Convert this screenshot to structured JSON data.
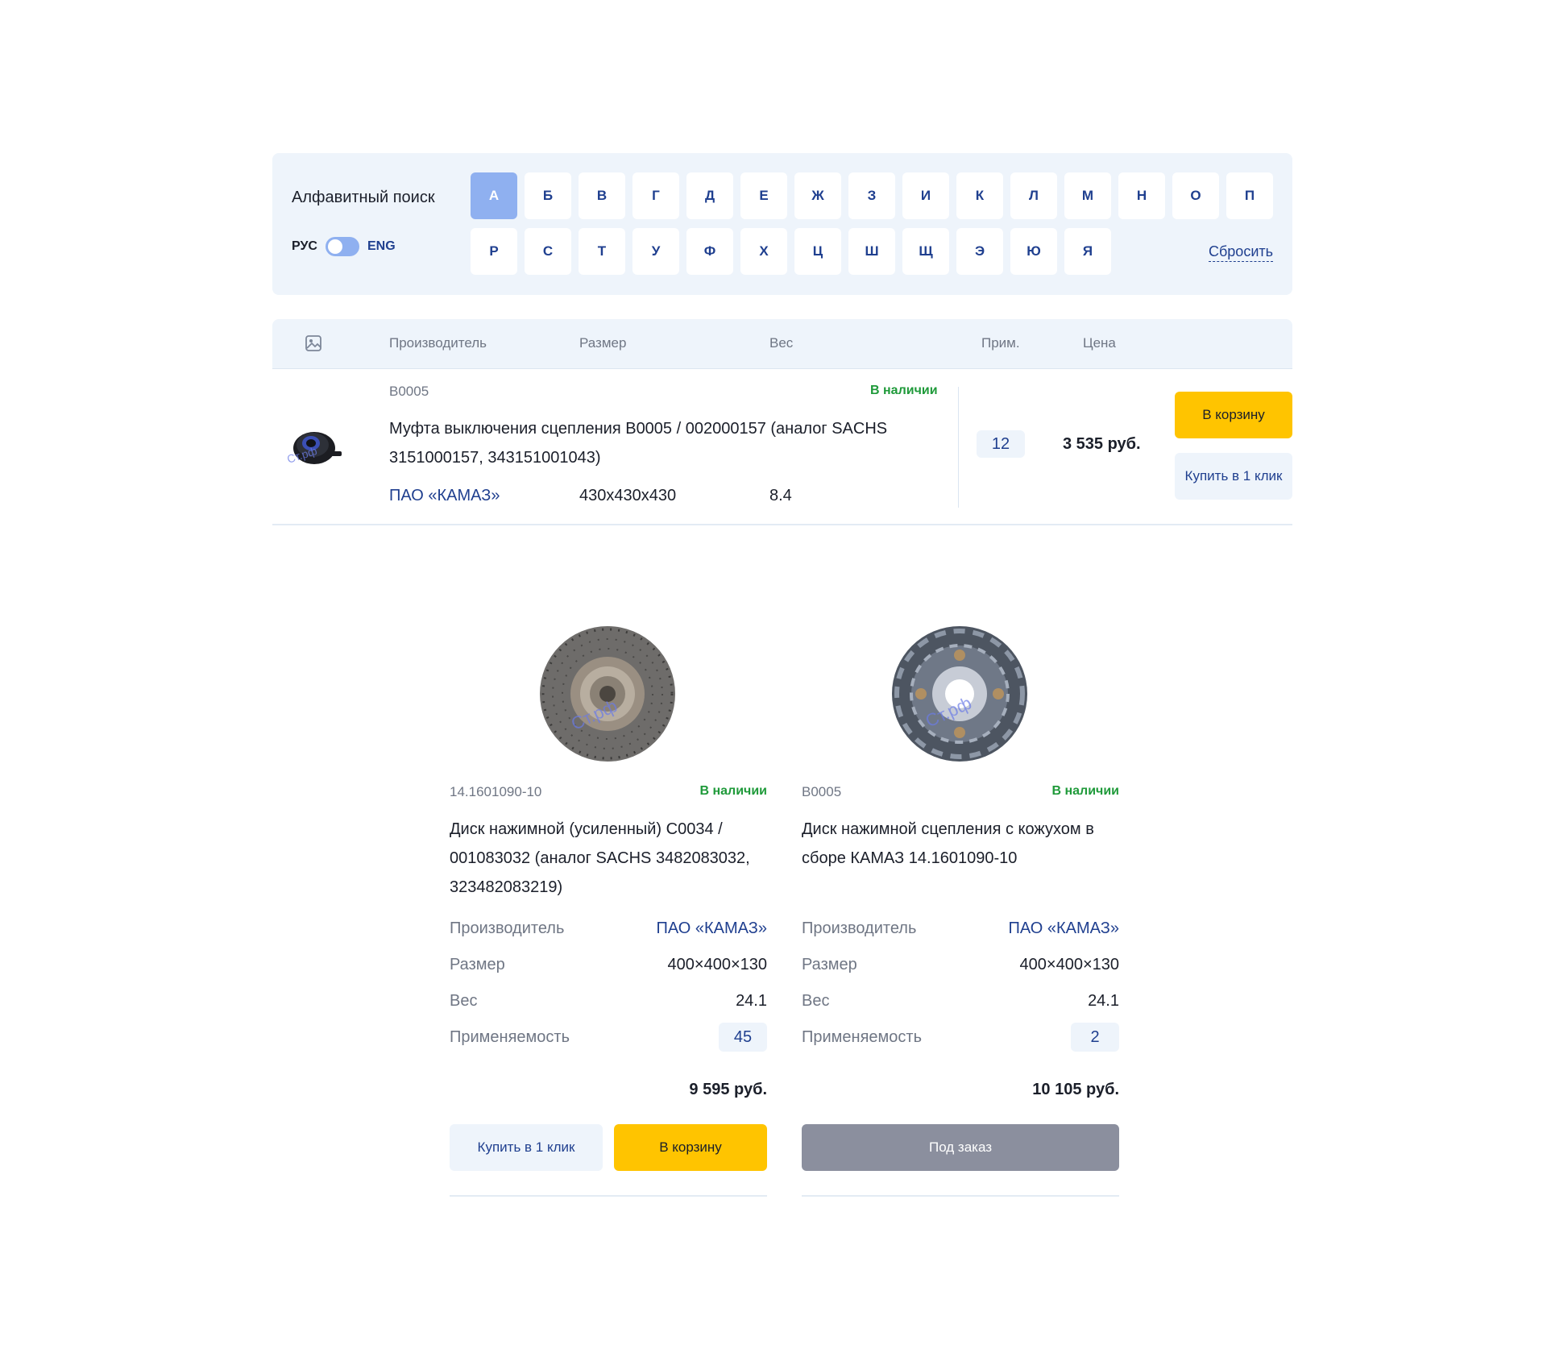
{
  "alphabet": {
    "title": "Алфавитный поиск",
    "lang_ru": "РУС",
    "lang_en": "ENG",
    "row1": [
      "А",
      "Б",
      "В",
      "Г",
      "Д",
      "Е",
      "Ж",
      "З",
      "И",
      "К",
      "Л",
      "М",
      "Н",
      "О",
      "П"
    ],
    "row2": [
      "Р",
      "С",
      "Т",
      "У",
      "Ф",
      "Х",
      "Ц",
      "Ш",
      "Щ",
      "Э",
      "Ю",
      "Я"
    ],
    "active_letter": "А",
    "reset_label": "Сбросить"
  },
  "table": {
    "headers": {
      "image_icon": "image-icon",
      "maker": "Производитель",
      "size": "Размер",
      "weight": "Вес",
      "applicability": "Прим.",
      "price": "Цена"
    },
    "rows": [
      {
        "sku": "B0005",
        "stock": "В наличии",
        "title": "Муфта выключения сцепления B0005 / 002000157 (аналог SACHS 3151000157, 343151001043)",
        "maker": "ПАО «КАМАЗ»",
        "size": "430x430x430",
        "weight": "8.4",
        "applicability": "12",
        "price": "3 535 руб.",
        "cart_label": "В корзину",
        "one_click_label": "Купить в 1 клик"
      }
    ]
  },
  "cards": [
    {
      "sku": "14.1601090-10",
      "stock": "В наличии",
      "title": "Диск нажимной (усиленный) C0034 / 001083032 (аналог SACHS 3482083032, 323482083219)",
      "specs": {
        "maker_label": "Производитель",
        "maker": "ПАО «КАМАЗ»",
        "size_label": "Размер",
        "size": "400×400×130",
        "weight_label": "Вес",
        "weight": "24.1",
        "applicability_label": "Применяемость",
        "applicability": "45"
      },
      "price": "9 595 руб.",
      "one_click_label": "Купить в 1 клик",
      "cart_label": "В корзину"
    },
    {
      "sku": "B0005",
      "stock": "В наличии",
      "title": "Диск нажимной сцепления с кожухом в сборе КАМАЗ 14.1601090-10",
      "specs": {
        "maker_label": "Производитель",
        "maker": "ПАО «КАМАЗ»",
        "size_label": "Размер",
        "size": "400×400×130",
        "weight_label": "Вес",
        "weight": "24.1",
        "applicability_label": "Применяемость",
        "applicability": "2"
      },
      "price": "10 105 руб.",
      "order_label": "Под заказ"
    }
  ],
  "colors": {
    "accent_yellow": "#ffc400",
    "brand_blue": "#1f3f8f",
    "active_letter_bg": "#8fb0f0",
    "panel_bg": "#eef4fb",
    "stock_green": "#1f9a3a",
    "order_gray": "#8b8f9e"
  }
}
